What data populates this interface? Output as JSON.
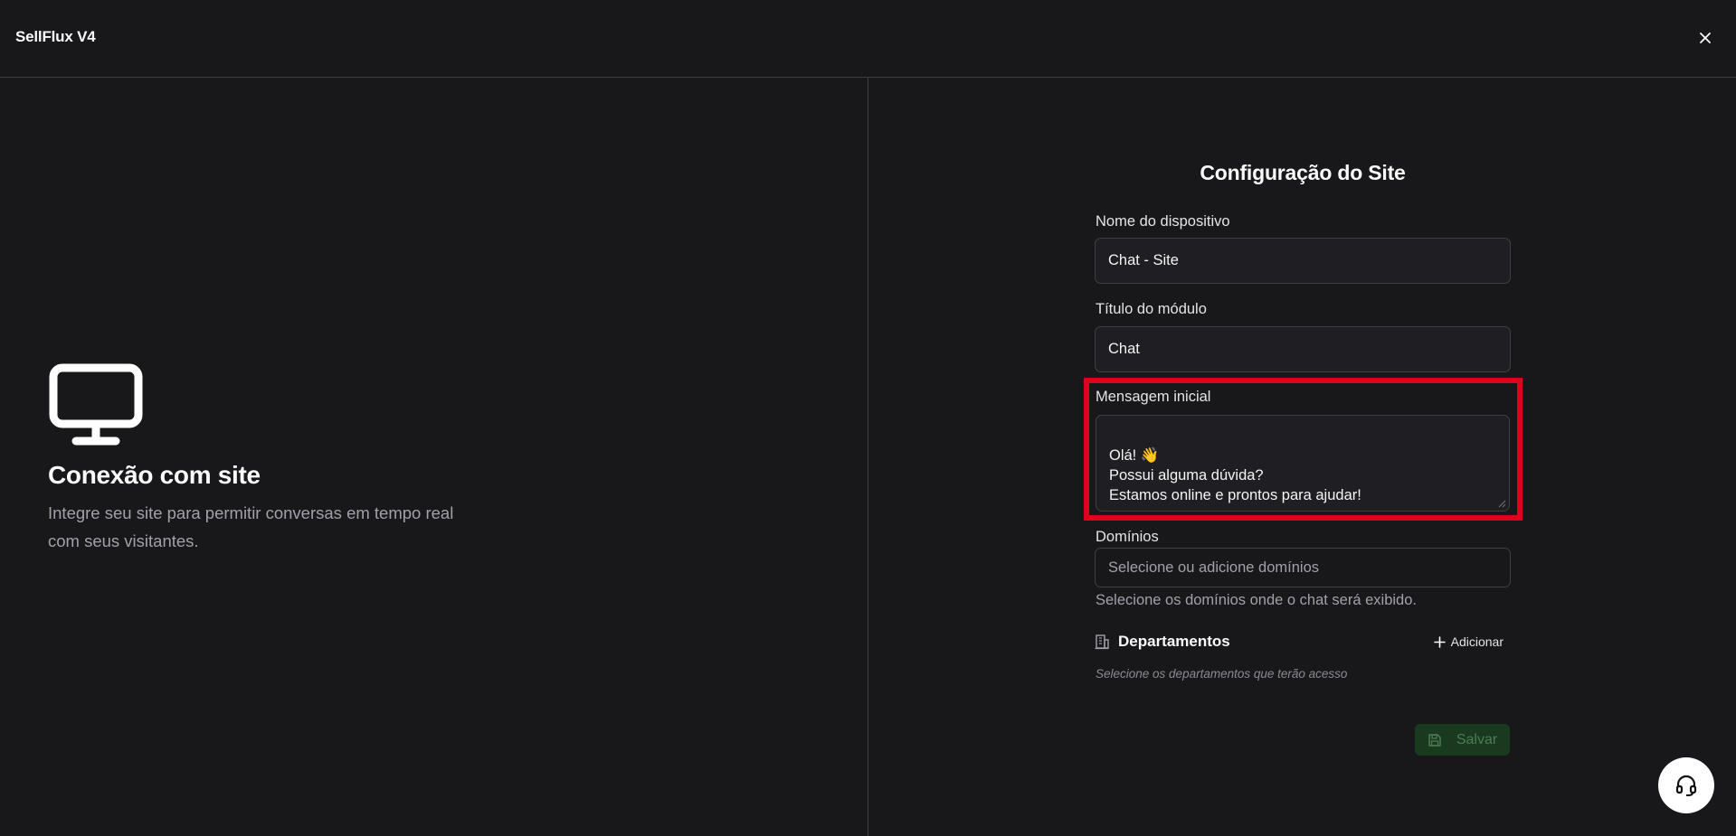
{
  "header": {
    "app_title": "SellFlux V4"
  },
  "left": {
    "icon": "monitor-icon",
    "title": "Conexão com site",
    "description_line1": "Integre seu site para permitir conversas em tempo real",
    "description_line2": "com seus visitantes."
  },
  "form": {
    "title": "Configuração do Site",
    "device_name": {
      "label": "Nome do dispositivo",
      "value": "Chat - Site"
    },
    "module_title": {
      "label": "Título do módulo",
      "value": "Chat"
    },
    "initial_message": {
      "label": "Mensagem inicial",
      "value": "Olá! 👋\nPossui alguma dúvida?\nEstamos online e prontos para ajudar!"
    },
    "domains": {
      "label": "Domínios",
      "placeholder": "Selecione ou adicione domínios",
      "helper": "Selecione os domínios onde o chat será exibido."
    },
    "departments": {
      "icon": "building-icon",
      "title": "Departamentos",
      "add_label": "Adicionar",
      "hint": "Selecione os departamentos que terão acesso"
    },
    "save_label": "Salvar"
  },
  "colors": {
    "background": "#18181b",
    "highlight": "#e0001b",
    "save_button_bg": "#1a3a20"
  }
}
